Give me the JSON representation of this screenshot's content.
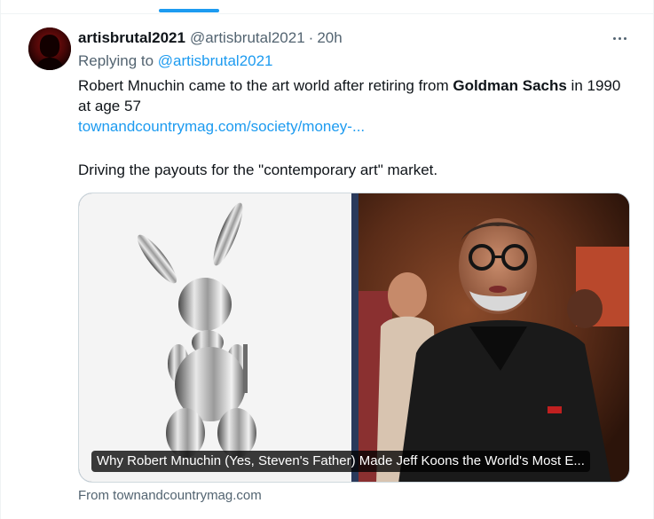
{
  "tweet": {
    "display_name": "artisbrutal2021",
    "handle": "@artisbrutal2021",
    "separator": "·",
    "time": "20h",
    "replying_prefix": "Replying to",
    "replying_handle": "@artisbrutal2021",
    "text_part1": "Robert Mnuchin came to the art world after retiring from ",
    "text_bold": "Goldman Sachs",
    "text_part2": " in 1990 at age 57",
    "link": "townandcountrymag.com/society/money-...",
    "text_para2": "Driving the payouts for the \"contemporary art\" market."
  },
  "card": {
    "caption": "Why Robert Mnuchin (Yes, Steven's Father) Made Jeff Koons the World's Most E...",
    "source": "From townandcountrymag.com"
  },
  "icons": {
    "more": "more-horizontal-icon",
    "avatar": "red-hooded-figure-avatar"
  },
  "colors": {
    "accent": "#1d9bf0",
    "text_primary": "#0f1419",
    "text_secondary": "#536471",
    "card_border_blue": "#2a3a5c"
  }
}
